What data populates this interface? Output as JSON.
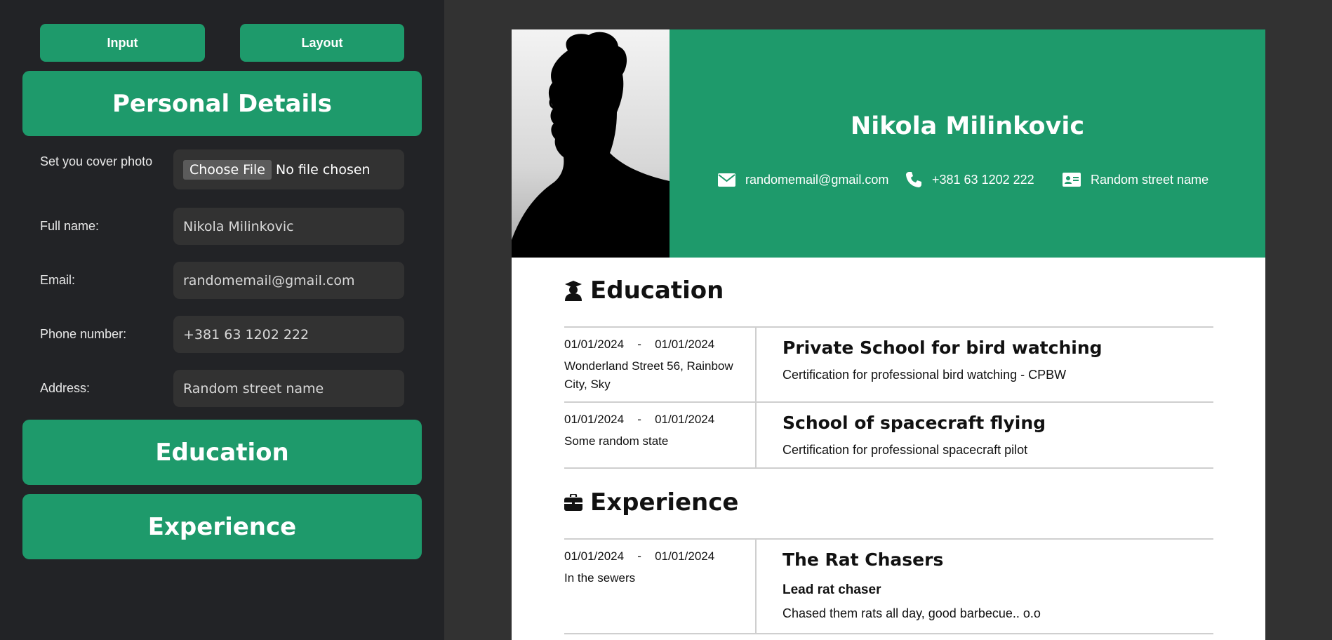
{
  "sidebar": {
    "tabs": [
      {
        "label": "Input"
      },
      {
        "label": "Layout"
      }
    ],
    "sections": {
      "personal": "Personal Details",
      "education": "Education",
      "experience": "Experience"
    },
    "fields": {
      "cover_photo": {
        "label": "Set you cover photo",
        "button": "Choose File",
        "status": "No file chosen"
      },
      "full_name": {
        "label": "Full name:",
        "value": "Nikola Milinkovic"
      },
      "email": {
        "label": "Email:",
        "value": "randomemail@gmail.com"
      },
      "phone": {
        "label": "Phone number:",
        "value": "+381 63 1202 222"
      },
      "address": {
        "label": "Address:",
        "value": "Random street name"
      }
    }
  },
  "resume": {
    "name": "Nikola Milinkovic",
    "contacts": {
      "email": "randomemail@gmail.com",
      "phone": "+381 63 1202 222",
      "address": "Random street name"
    },
    "education_title": "Education",
    "education": [
      {
        "start": "01/01/2024",
        "separator": "-",
        "end": "01/01/2024",
        "location": "Wonderland Street 56, Rainbow City, Sky",
        "school": "Private School for bird watching",
        "description": "Certification for professional bird watching - CPBW"
      },
      {
        "start": "01/01/2024",
        "separator": "-",
        "end": "01/01/2024",
        "location": "Some random state",
        "school": "School of spacecraft flying",
        "description": "Certification for professional spacecraft pilot"
      }
    ],
    "experience_title": "Experience",
    "experience": [
      {
        "start": "01/01/2024",
        "separator": "-",
        "end": "01/01/2024",
        "location": "In the sewers",
        "company": "The Rat Chasers",
        "position": "Lead rat chaser",
        "description": "Chased them rats all day, good barbecue.. o.o"
      }
    ]
  },
  "colors": {
    "accent": "#1e9a6b",
    "sidebar_bg": "#222326",
    "page_bg": "#323232",
    "field_bg": "#323232"
  },
  "icons": {
    "email": "envelope-icon",
    "phone": "phone-icon",
    "address": "address-card-icon",
    "education": "graduate-icon",
    "experience": "briefcase-icon"
  }
}
